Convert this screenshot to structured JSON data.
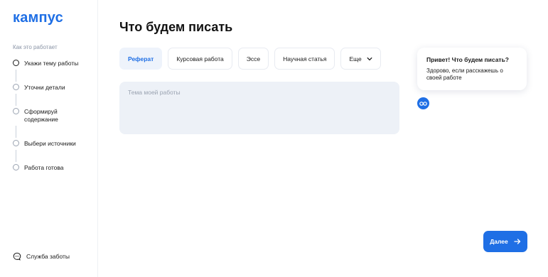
{
  "brand": {
    "logo_text": "кампус",
    "accent_color": "#1f6fe5"
  },
  "sidebar": {
    "how_title": "Как это работает",
    "steps": [
      {
        "label": "Укажи тему работы",
        "state": "active"
      },
      {
        "label": "Уточни детали",
        "state": "inactive"
      },
      {
        "label": "Сформируй содержание",
        "state": "inactive"
      },
      {
        "label": "Выбери источники",
        "state": "inactive"
      },
      {
        "label": "Работа готова",
        "state": "inactive"
      }
    ],
    "support_label": "Служба заботы",
    "support_icon": "chat-icon"
  },
  "main": {
    "title": "Что будем писать",
    "tabs": [
      {
        "label": "Реферат",
        "active": true
      },
      {
        "label": "Курсовая работа",
        "active": false
      },
      {
        "label": "Эссе",
        "active": false
      },
      {
        "label": "Научная статья",
        "active": false
      },
      {
        "label": "Еще",
        "active": false,
        "icon": "chevron-down-icon"
      }
    ],
    "topic_input": {
      "placeholder": "Тема моей работы",
      "value": ""
    }
  },
  "assistant": {
    "greeting_title": "Привет! Что будем писать?",
    "greeting_text": "Здорово, если расскажешь о своей работе",
    "avatar_icon": "bot-avatar-icon"
  },
  "footer": {
    "next_label": "Далее",
    "next_icon": "arrow-right-icon"
  }
}
